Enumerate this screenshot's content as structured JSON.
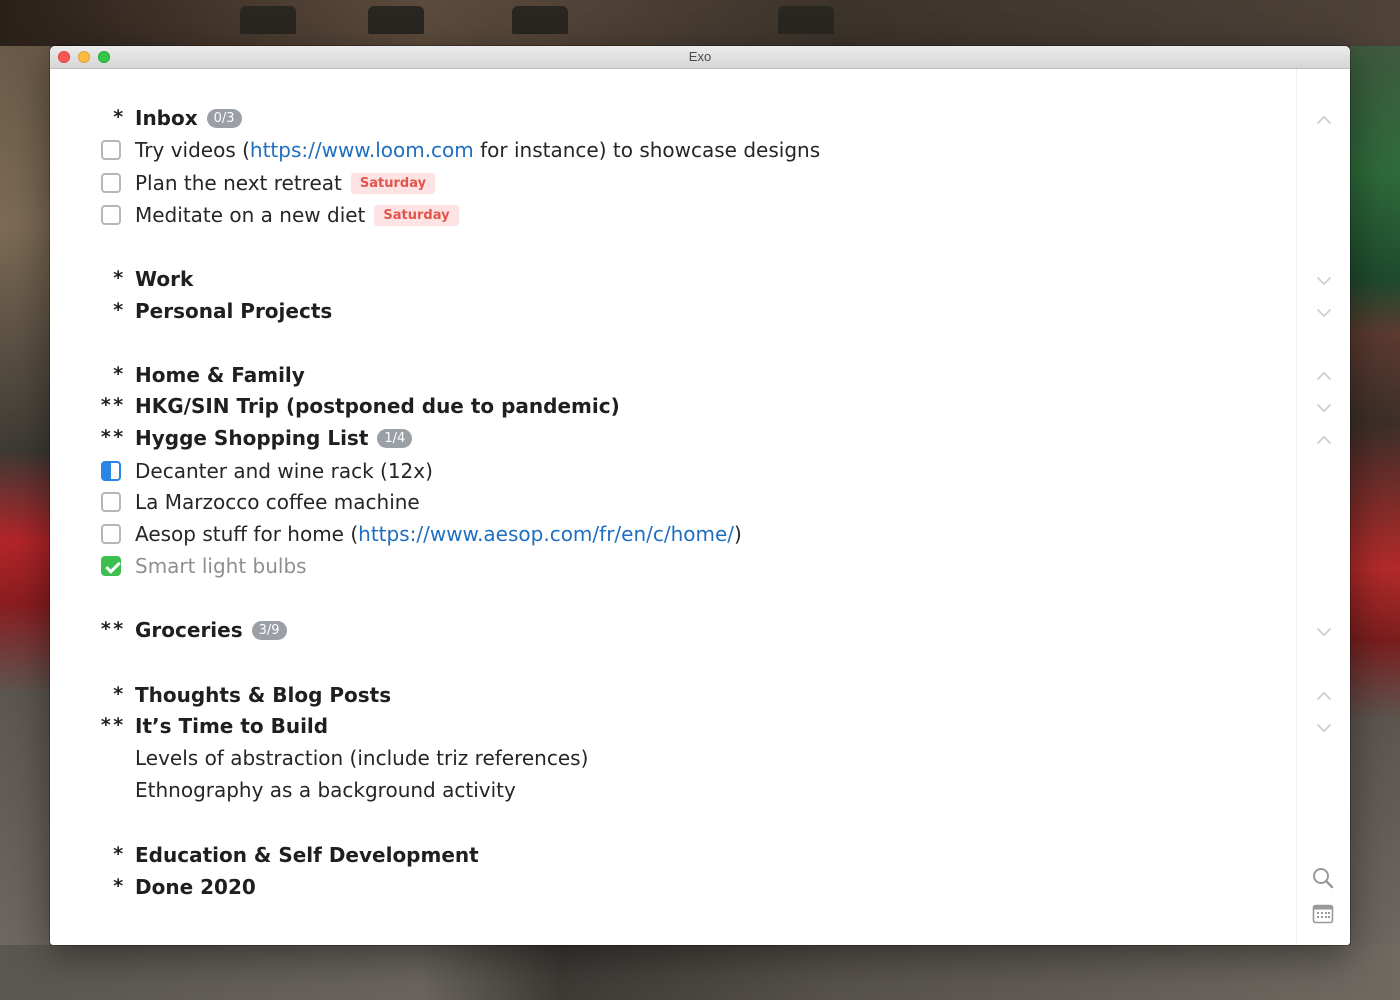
{
  "window": {
    "title": "Exo"
  },
  "outline": {
    "inbox": {
      "marker": "*",
      "title": "Inbox",
      "count": "0/3"
    },
    "inbox_items": [
      {
        "pre": "Try videos (",
        "link": "https://www.loom.com",
        "post": " for instance) to showcase designs",
        "state": "unchecked"
      },
      {
        "text": "Plan the next retreat",
        "tag": "Saturday",
        "state": "unchecked"
      },
      {
        "text": "Meditate on a new diet",
        "tag": "Saturday",
        "state": "unchecked"
      }
    ],
    "work": {
      "marker": "*",
      "title": "Work"
    },
    "personal": {
      "marker": "*",
      "title": "Personal Projects"
    },
    "home": {
      "marker": "*",
      "title": "Home & Family"
    },
    "trip": {
      "marker": "**",
      "title": "HKG/SIN Trip (postponed due to pandemic)"
    },
    "hygge": {
      "marker": "**",
      "title": "Hygge Shopping List",
      "count": "1/4"
    },
    "hygge_items": [
      {
        "text": "Decanter and wine rack (12x)",
        "state": "in-progress"
      },
      {
        "text": "La Marzocco coffee machine",
        "state": "unchecked"
      },
      {
        "pre": "Aesop stuff for home (",
        "link": "https://www.aesop.com/fr/en/c/home/",
        "post": ")",
        "state": "unchecked"
      },
      {
        "text": "Smart light bulbs",
        "state": "checked"
      }
    ],
    "groceries": {
      "marker": "**",
      "title": "Groceries",
      "count": "3/9"
    },
    "thoughts": {
      "marker": "*",
      "title": "Thoughts & Blog Posts"
    },
    "build": {
      "marker": "**",
      "title": "It’s Time to Build"
    },
    "build_notes": [
      "Levels of abstraction (include triz references)",
      "Ethnography as a background activity"
    ],
    "education": {
      "marker": "*",
      "title": "Education & Self Development"
    },
    "done2020": {
      "marker": "*",
      "title": "Done 2020"
    }
  },
  "gutter": {
    "icons": [
      "chevron-up-icon",
      "chevron-down-icon",
      "search-icon",
      "calendar-icon"
    ]
  },
  "colors": {
    "link": "#1f6fc0",
    "tag_bg": "#fde3e3",
    "tag_text": "#e0564f",
    "badge_bg": "#9aa0a6",
    "checked": "#3cbf4e",
    "in_progress": "#2a86e6"
  }
}
